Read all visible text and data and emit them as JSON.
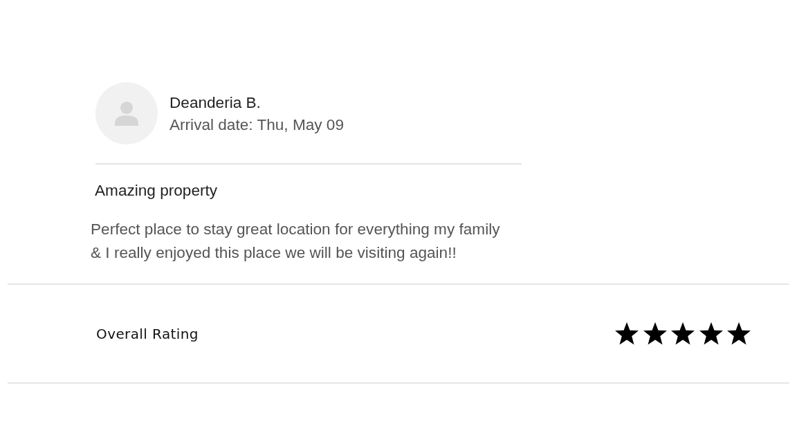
{
  "review": {
    "reviewer": "Deanderia B.",
    "arrival": "Arrival date: Thu, May 09",
    "title": "Amazing property",
    "body": "Perfect place to stay great location for everything my family & I really enjoyed this place we will be visiting again!!"
  },
  "rating": {
    "label": "Overall Rating",
    "stars": 5
  }
}
